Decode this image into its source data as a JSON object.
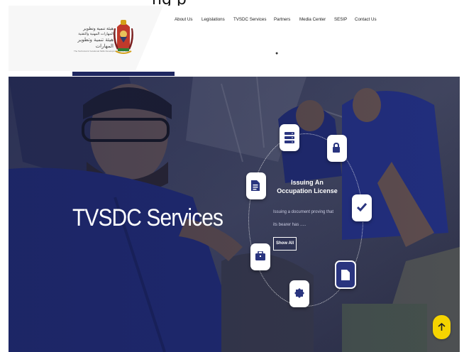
{
  "top_strip": {
    "text": "ng p"
  },
  "logo": {
    "arabic_line1": "هيئة تنمية وتطوير",
    "arabic_line2": "المهارات المهنية والتقنية",
    "arabic_line3": "هيئة تنمية وتطوير المهارات",
    "english": "The Technical & Vocational Skills Development Commission"
  },
  "nav": {
    "items": [
      "About Us",
      "Legislations",
      "TVSDC Services",
      "Partners",
      "Media Center",
      "SESIP",
      "Contact Us"
    ]
  },
  "hero": {
    "title": "TVSDC Services",
    "service_title": "Issuing An Occupation License",
    "service_desc_line1": "Issuing a document proving that",
    "service_desc_line2": "its bearer has .....",
    "show_all": "Show All"
  },
  "service_icons": [
    "server-icon",
    "lock-icon",
    "checkmark-icon",
    "document-icon",
    "badge-icon",
    "briefcase-icon",
    "file-text-icon"
  ],
  "colors": {
    "brand_navy": "#1e2760",
    "accent_yellow": "#f5d400",
    "active_card": "#2a357f"
  }
}
